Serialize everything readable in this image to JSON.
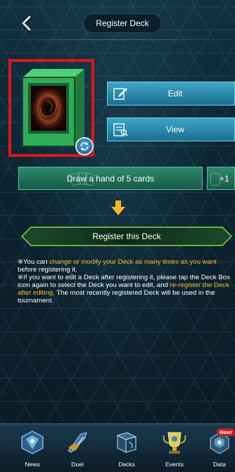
{
  "header": {
    "title": "Register Deck",
    "back_icon": "chevron-left-icon"
  },
  "deck": {
    "highlight_color": "#e0151a",
    "swap_icon": "swap-arrows-icon"
  },
  "actions": {
    "edit_label": "Edit",
    "view_label": "View",
    "draw_label": "Draw a hand of 5 cards",
    "plus_label": "+1",
    "register_label": "Register this Deck"
  },
  "notes": {
    "line1_a": "※You can ",
    "line1_b": "change or modify your Deck as many times as you want",
    "line1_c": " before registering it.",
    "line2_a": "※If you want to edit a Deck after registering it, please tap the Deck Box icon again to select the Deck you want to edit, and ",
    "line2_b": "re-register the Deck after editing.",
    "line2_c": " The most recently registered Deck will be used in the tournament."
  },
  "colors": {
    "accent": "#f6b62b",
    "highlight": "#e0151a"
  },
  "nav": {
    "items": [
      {
        "label": "News",
        "icon": "news-icon"
      },
      {
        "label": "Duel",
        "icon": "duel-icon"
      },
      {
        "label": "Decks",
        "icon": "decks-icon"
      },
      {
        "label": "Events",
        "icon": "events-icon"
      },
      {
        "label": "Data",
        "icon": "data-icon"
      }
    ],
    "badge": "New!"
  }
}
